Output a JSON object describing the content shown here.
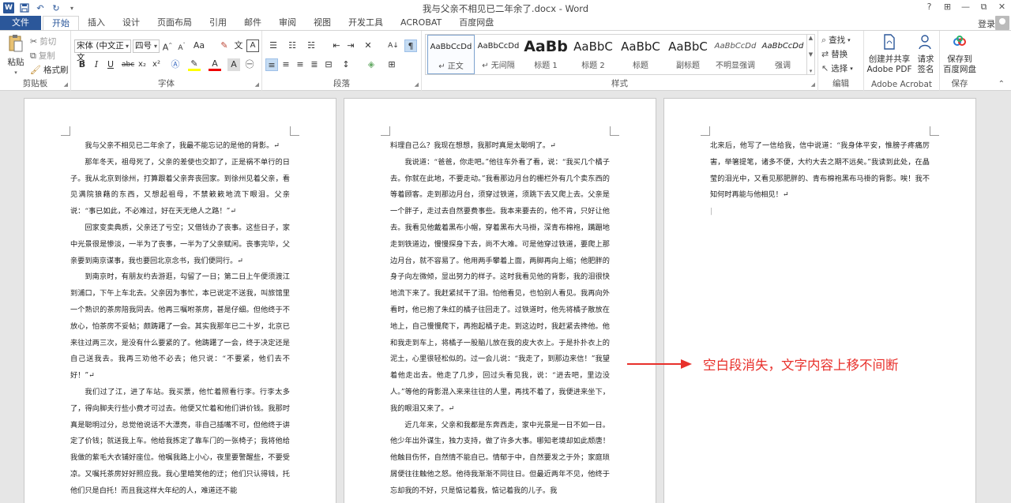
{
  "window": {
    "title": "我与父亲不相见已二年余了.docx - Word",
    "help": "?",
    "ribbon_display": "⊞",
    "minimize": "—",
    "restore": "⧉",
    "close": "✕"
  },
  "qat": {
    "word_icon": "W",
    "save_icon": "save-icon",
    "undo": "↶",
    "redo": "↻",
    "more": "▾"
  },
  "tabs": [
    "文件",
    "开始",
    "插入",
    "设计",
    "页面布局",
    "引用",
    "邮件",
    "审阅",
    "视图",
    "开发工具",
    "ACROBAT",
    "百度网盘"
  ],
  "active_tab_index": 1,
  "account": {
    "login": "登录"
  },
  "clipboard": {
    "paste": "粘贴",
    "cut": "剪切",
    "copy": "复制",
    "format_painter": "格式刷",
    "label": "剪贴板"
  },
  "font": {
    "font_name": "宋体 (中文正文",
    "font_size": "四号",
    "label": "字体"
  },
  "paragraph": {
    "label": "段落"
  },
  "styles": {
    "label": "样式",
    "items": [
      {
        "preview": "AaBbCcDd",
        "name": "↵ 正文"
      },
      {
        "preview": "AaBbCcDd",
        "name": "↵ 无间隔"
      },
      {
        "preview": "AaBb",
        "name": "标题 1"
      },
      {
        "preview": "AaBbC",
        "name": "标题 2"
      },
      {
        "preview": "AaBbC",
        "name": "标题"
      },
      {
        "preview": "AaBbC",
        "name": "副标题"
      },
      {
        "preview": "AaBbCcDd",
        "name": "不明显强调"
      },
      {
        "preview": "AaBbCcDd",
        "name": "强调"
      }
    ]
  },
  "editing": {
    "find": "查找",
    "replace": "替换",
    "select": "选择",
    "label": "编辑"
  },
  "acrobat": {
    "create_pdf": "创建并共享\nAdobe PDF",
    "request_sign": "请求\n签名",
    "label": "Adobe Acrobat"
  },
  "save_group": {
    "save_baidu": "保存到\n百度网盘",
    "label": "保存"
  },
  "pages": [
    {
      "paragraphs": [
        "我与父亲不相见已二年余了，我最不能忘记的是他的背影。↵",
        "那年冬天，祖母死了，父亲的差使也交卸了，正是祸不单行的日子。我从北京到徐州，打算跟着父亲奔丧回家。到徐州见着父亲，看见满院狼藉的东西，又想起祖母，不禁簌簌地流下眼泪。父亲说：“事已如此，不必难过，好在天无绝人之路！”↵",
        "回家变卖典质，父亲还了亏空；又借钱办了丧事。这些日子，家中光景很是惨淡，一半为了丧事，一半为了父亲赋闲。丧事完毕，父亲要到南京谋事，我也要回北京念书，我们便同行。↵",
        "到南京时，有朋友约去游逛，勾留了一日；第二日上午便须渡江到浦口，下午上车北去。父亲因为事忙，本已说定不送我，叫旅馆里一个熟识的茶房陪我同去。他再三嘱咐茶房，甚是仔细。但他终于不放心，怕茶房不妥帖；颇踌躇了一会。其实我那年已二十岁，北京已来往过两三次，是没有什么要紧的了。他踌躇了一会，终于决定还是自己送我去。我再三劝他不必去；他只说：“不要紧，他们去不好！”↵",
        "我们过了江，进了车站。我买票，他忙着照看行李。行李太多了，得向脚夫行些小费才可过去。他便又忙着和他们讲价钱。我那时真是聪明过分，总觉他说话不大漂亮，非自己插嘴不可，但他终于讲定了价钱；就送我上车。他给我拣定了靠车门的一张椅子；我将他给我做的紫毛大衣铺好座位。他嘱我路上小心，夜里要警醒些，不要受凉。又嘱托茶房好好照应我。我心里暗笑他的迂；他们只认得钱，托他们只是白托！而且我这样大年纪的人，难道还不能"
      ]
    },
    {
      "paragraphs": [
        "料理自己么？我现在想想，我那时真是太聪明了。↵",
        "我说道：“爸爸，你走吧。”他往车外看了看，说：“我买几个橘子去。你就在此地，不要走动。”我看那边月台的栅栏外有几个卖东西的等着顾客。走到那边月台，须穿过铁道，须跳下去又爬上去。父亲是一个胖子，走过去自然要费事些。我本来要去的，他不肯，只好让他去。我看见他戴着黑布小帽，穿着黑布大马褂，深青布棉袍，蹒跚地走到铁道边，慢慢探身下去，尚不大难。可是他穿过铁道，要爬上那边月台，就不容易了。他用两手攀着上面，两脚再向上缩；他肥胖的身子向左微倾，显出努力的样子。这时我看见他的背影，我的泪很快地流下来了。我赶紧拭干了泪。怕他看见，也怕别人看见。我再向外看时，他已抱了朱红的橘子往回走了。过铁道时，他先将橘子散放在地上，自己慢慢爬下，再抱起橘子走。到这边时，我赶紧去搀他。他和我走到车上，将橘子一股脑儿放在我的皮大衣上。于是扑扑衣上的泥土，心里很轻松似的。过一会儿说：“我走了，到那边来信！”我望着他走出去。他走了几步，回过头看见我，说：“进去吧，里边没人。”等他的背影混入来来往往的人里，再找不着了，我便进来坐下，我的眼泪又来了。↵",
        "近几年来，父亲和我都是东奔西走，家中光景是一日不如一日。他少年出外谋生，独力支持，做了许多大事。哪知老境却如此颓唐！他触目伤怀，自然情不能自已。情郁于中，自然要发之于外；家庭琐屑便往往触他之怒。他待我渐渐不同往日。但最近两年不见，他终于忘却我的不好，只是惦记着我，惦记着我的儿子。我"
      ]
    },
    {
      "paragraphs": [
        "北来后，他写了一信给我，信中说道：“我身体平安，惟膀子疼痛厉害，举箸提笔，诸多不便，大约大去之期不远矣。”我读到此处，在晶莹的泪光中，又看见那肥胖的、青布棉袍黑布马褂的背影。唉！我不知何时再能与他相见！↵"
      ]
    }
  ],
  "annotation": "空白段消失，文字内容上移不间断"
}
